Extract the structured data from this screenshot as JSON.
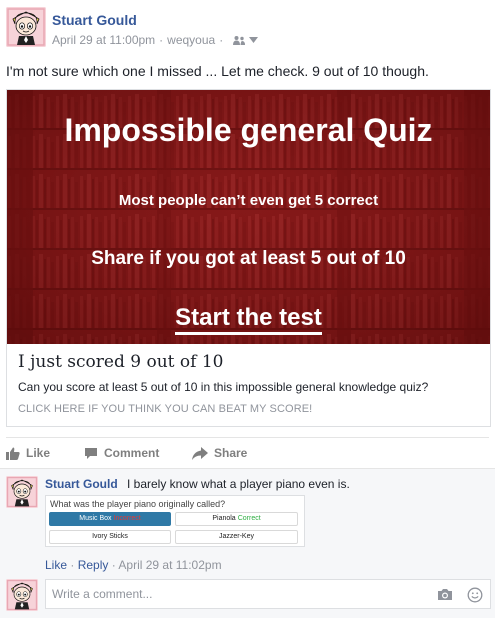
{
  "post": {
    "author": "Stuart Gould",
    "timestamp": "April 29 at 11:00pm",
    "app": "weqyoua",
    "text": "I'm not sure which one I missed ... Let me check. 9 out of 10 though."
  },
  "link_card": {
    "banner_title": "Impossible general Quiz",
    "banner_line1": "Most people can’t even get  5 correct",
    "banner_line2": "Share if you got at least 5 out of 10",
    "banner_cta": "Start the test",
    "title": "I just scored 9 out of 10",
    "description": "Can you score at least 5 out of 10 in this impossible general knowledge quiz?",
    "caption": "CLICK HERE IF YOU THINK YOU CAN BEAT MY SCORE!"
  },
  "actions": {
    "like": "Like",
    "comment": "Comment",
    "share": "Share"
  },
  "comment": {
    "author": "Stuart Gould",
    "text": "I barely know what a player piano even is.",
    "attachment": {
      "question": "What was the player piano originally called?",
      "options": [
        {
          "label": "Music Box",
          "mark": "Incorrect"
        },
        {
          "label": "Pianola",
          "mark": "Correct"
        },
        {
          "label": "Ivory Sticks",
          "mark": ""
        },
        {
          "label": "Jazzer-Key",
          "mark": ""
        }
      ]
    },
    "like_link": "Like",
    "reply_link": "Reply",
    "timestamp": "April 29 at 11:02pm"
  },
  "composer": {
    "placeholder": "Write a comment..."
  },
  "colors": {
    "link_blue": "#365899",
    "banner_red": "#8b1a1a",
    "chosen_blue": "#2f79a6",
    "incorrect_red": "#e53935",
    "correct_green": "#2eae42"
  },
  "icons": [
    "avatar",
    "friends-audience-icon",
    "caret-down-icon",
    "thumbs-up-icon",
    "comment-icon",
    "share-arrow-icon",
    "camera-icon",
    "smiley-icon"
  ]
}
